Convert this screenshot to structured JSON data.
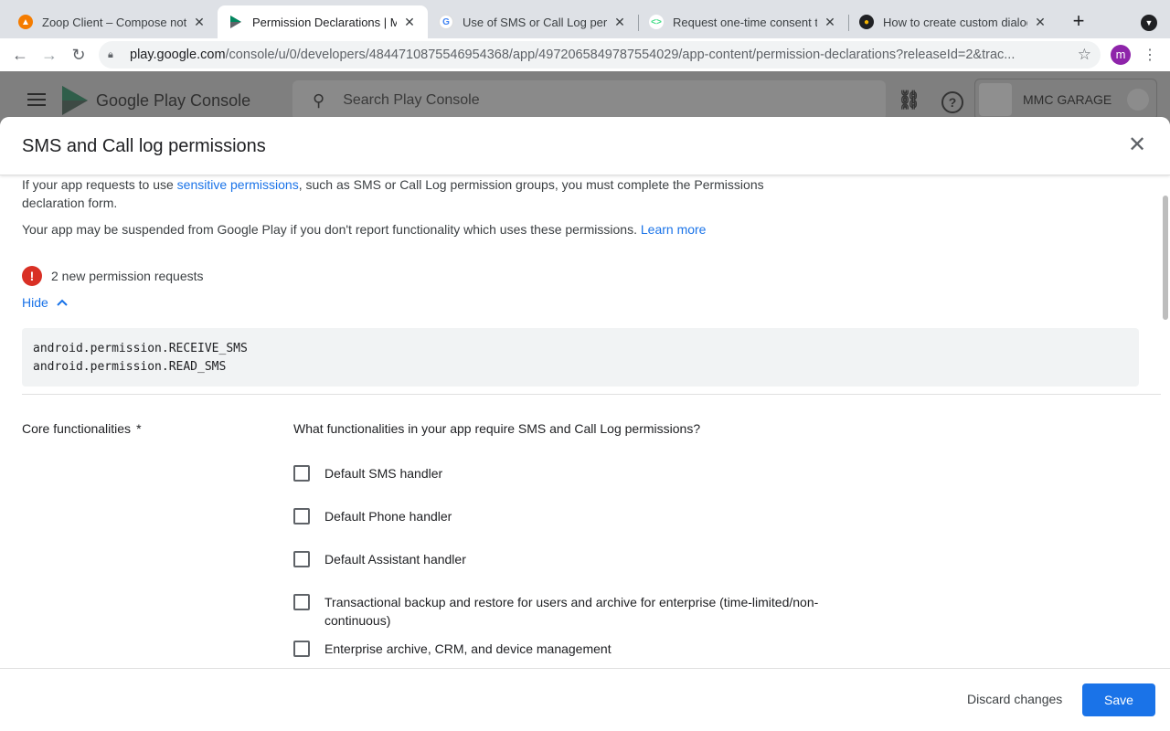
{
  "browser": {
    "tabs": [
      {
        "title": "Zoop Client – Compose notifi",
        "favicon": "firebase-icon",
        "active": false
      },
      {
        "title": "Permission Declarations | MM",
        "favicon": "play-console-icon",
        "active": true
      },
      {
        "title": "Use of SMS or Call Log permi",
        "favicon": "google-icon",
        "active": false
      },
      {
        "title": "Request one-time consent to",
        "favicon": "android-dev-icon",
        "active": false
      },
      {
        "title": "How to create custom dialog",
        "favicon": "stackoverflow-icon",
        "active": false
      }
    ],
    "url_host": "play.google.com",
    "url_path": "/console/u/0/developers/4844710875546954368/app/4972065849787554029/app-content/permission-declarations?releaseId=2&trac...",
    "profile_initial": "m"
  },
  "console": {
    "brand": "Google Play Console",
    "search_placeholder": "Search Play Console",
    "developer_name": "MMC GARAGE"
  },
  "dialog": {
    "title": "SMS and Call log permissions",
    "intro_before_link": "If your app requests to use ",
    "intro_link": "sensitive permissions",
    "intro_after_link": ", such as SMS or Call Log permission groups, you must complete the Permissions declaration form.",
    "suspend_text": "Your app may be suspended from Google Play if you don't report functionality which uses these permissions.",
    "learn_more": "Learn more",
    "warning_text": "2 new permission requests",
    "hide_label": "Hide",
    "permissions": [
      "android.permission.RECEIVE_SMS",
      "android.permission.READ_SMS"
    ],
    "core_label": "Core functionalities",
    "required_mark": "*",
    "question": "What functionalities in your app require SMS and Call Log permissions?",
    "options": [
      {
        "label": "Default SMS handler",
        "checked": false
      },
      {
        "label": "Default Phone handler",
        "checked": false
      },
      {
        "label": "Default Assistant handler",
        "checked": false
      },
      {
        "label": "Transactional backup and restore for users and archive for enterprise (time-limited/non-continuous)",
        "checked": false
      },
      {
        "label": "Enterprise archive, CRM, and device management",
        "checked": false
      }
    ],
    "discard_label": "Discard changes",
    "save_label": "Save"
  },
  "colors": {
    "accent": "#1a73e8",
    "error": "#d93025",
    "profile": "#8e24aa"
  }
}
